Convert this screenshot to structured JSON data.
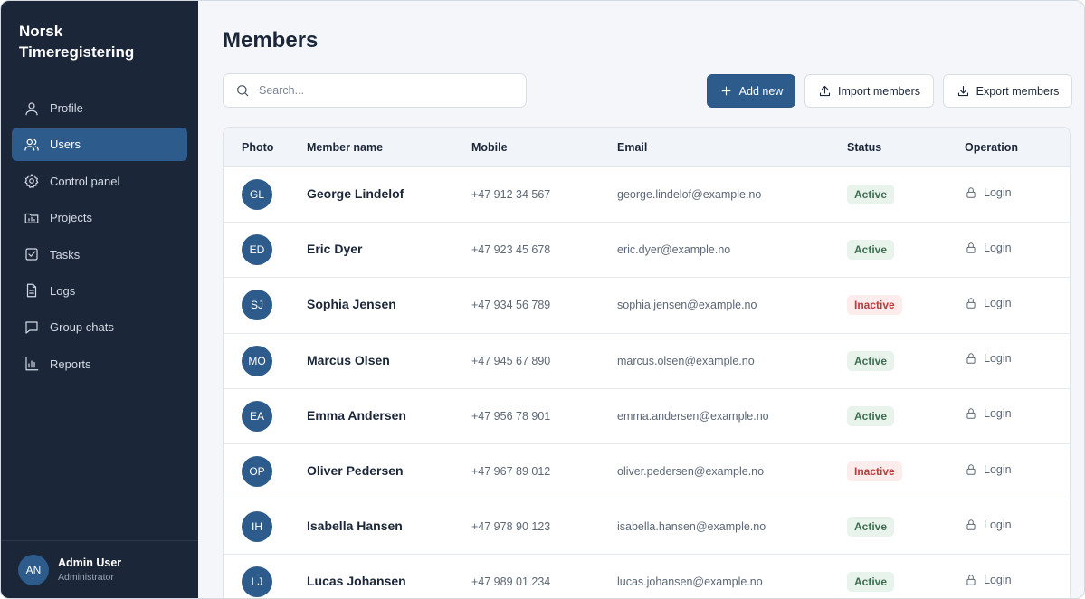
{
  "app": {
    "title": "Norsk Timeregistering"
  },
  "sidebar": {
    "items": [
      {
        "label": "Profile",
        "icon": "user-icon"
      },
      {
        "label": "Users",
        "icon": "users-icon",
        "active": true
      },
      {
        "label": "Control panel",
        "icon": "gear-icon"
      },
      {
        "label": "Projects",
        "icon": "folder-icon"
      },
      {
        "label": "Tasks",
        "icon": "checkbox-icon"
      },
      {
        "label": "Logs",
        "icon": "document-icon"
      },
      {
        "label": "Group chats",
        "icon": "chat-icon"
      },
      {
        "label": "Reports",
        "icon": "bar-chart-icon"
      }
    ],
    "user": {
      "initials": "AN",
      "name": "Admin User",
      "role": "Administrator"
    }
  },
  "main": {
    "title": "Members",
    "search": {
      "placeholder": "Search...",
      "value": ""
    },
    "buttons": {
      "add": "Add new",
      "import": "Import members",
      "export": "Export members"
    },
    "table": {
      "columns": [
        "Photo",
        "Member name",
        "Mobile",
        "Email",
        "Status",
        "Operation"
      ],
      "rows": [
        {
          "initials": "GL",
          "name": "George Lindelof",
          "mobile": "+47 912 34 567",
          "email": "george.lindelof@example.no",
          "status": "Active",
          "operation": "Login"
        },
        {
          "initials": "ED",
          "name": "Eric Dyer",
          "mobile": "+47 923 45 678",
          "email": "eric.dyer@example.no",
          "status": "Active",
          "operation": "Login"
        },
        {
          "initials": "SJ",
          "name": "Sophia Jensen",
          "mobile": "+47 934 56 789",
          "email": "sophia.jensen@example.no",
          "status": "Inactive",
          "operation": "Login"
        },
        {
          "initials": "MO",
          "name": "Marcus Olsen",
          "mobile": "+47 945 67 890",
          "email": "marcus.olsen@example.no",
          "status": "Active",
          "operation": "Login"
        },
        {
          "initials": "EA",
          "name": "Emma Andersen",
          "mobile": "+47 956 78 901",
          "email": "emma.andersen@example.no",
          "status": "Active",
          "operation": "Login"
        },
        {
          "initials": "OP",
          "name": "Oliver Pedersen",
          "mobile": "+47 967 89 012",
          "email": "oliver.pedersen@example.no",
          "status": "Inactive",
          "operation": "Login"
        },
        {
          "initials": "IH",
          "name": "Isabella Hansen",
          "mobile": "+47 978 90 123",
          "email": "isabella.hansen@example.no",
          "status": "Active",
          "operation": "Login"
        },
        {
          "initials": "LJ",
          "name": "Lucas Johansen",
          "mobile": "+47 989 01 234",
          "email": "lucas.johansen@example.no",
          "status": "Active",
          "operation": "Login"
        }
      ]
    }
  },
  "colors": {
    "sidebar": "#1b2638",
    "accent": "#2d5b8c",
    "active_badge": "#3f6e51",
    "inactive_badge": "#c0393b"
  }
}
